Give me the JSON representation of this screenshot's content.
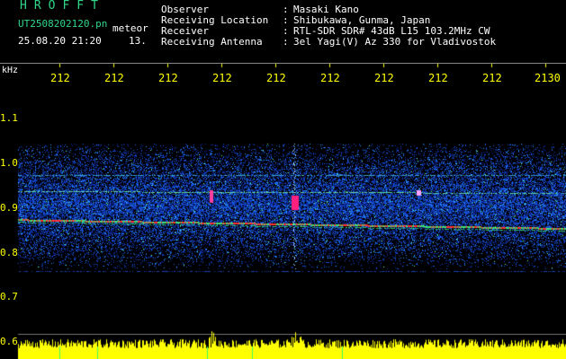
{
  "header": {
    "logo": "HROFFT",
    "filename": "UT2508202120.pn",
    "meteor_label": "meteor",
    "datetime": "25.08.20 21:20",
    "count": "13."
  },
  "info": [
    {
      "label": "Observer",
      "value": "Masaki Kano"
    },
    {
      "label": "Receiving Location",
      "value": "Shibukawa, Gunma, Japan"
    },
    {
      "label": "Receiver",
      "value": "RTL-SDR SDR# 43dB L15 103.2MHz CW"
    },
    {
      "label": "Receiving Antenna",
      "value": "3el Yagi(V) Az 330 for Vladivostok"
    }
  ],
  "axis": {
    "y_unit": "kHz",
    "y_ticks": [
      "1.1",
      "1.0",
      "0.9",
      "0.8",
      "0.7",
      "0.6"
    ],
    "x_ticks": [
      "212",
      "212",
      "212",
      "212",
      "212",
      "212",
      "212",
      "212",
      "212",
      "2130"
    ]
  },
  "colors": {
    "label_green": "#2fd88a",
    "tick_yellow": "#ffff00",
    "text_white": "#ffffff"
  }
}
